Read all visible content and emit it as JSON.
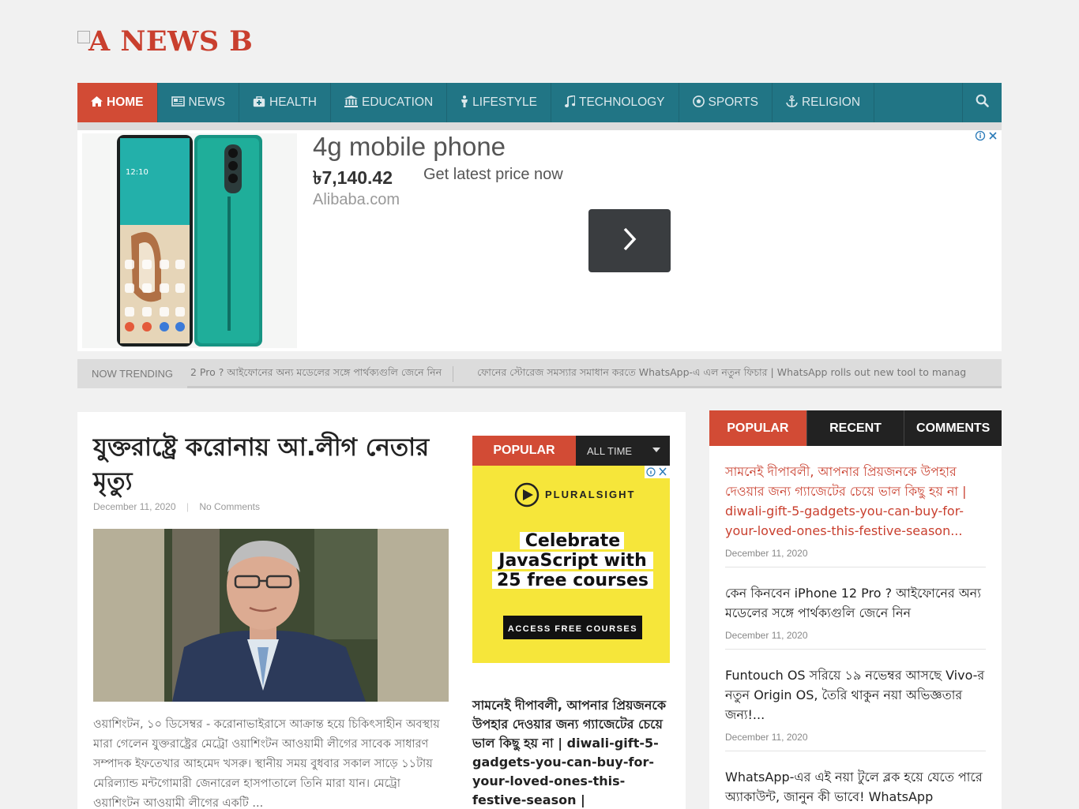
{
  "logo": {
    "text": "A NEWS B"
  },
  "nav": {
    "items": [
      {
        "label": "HOME",
        "icon": "home-icon"
      },
      {
        "label": "NEWS",
        "icon": "newspaper-icon"
      },
      {
        "label": "HEALTH",
        "icon": "medkit-icon"
      },
      {
        "label": "EDUCATION",
        "icon": "institution-icon"
      },
      {
        "label": "LIFESTYLE",
        "icon": "person-icon"
      },
      {
        "label": "TECHNOLOGY",
        "icon": "music-icon"
      },
      {
        "label": "SPORTS",
        "icon": "soccer-ball-icon"
      },
      {
        "label": "RELIGION",
        "icon": "anchor-icon"
      }
    ]
  },
  "ad": {
    "title": "4g mobile phone",
    "price": "৳7,140.42",
    "cta": "Get latest price now",
    "source": "Alibaba.com"
  },
  "trending": {
    "label": "NOW TRENDING",
    "items": [
      "2 Pro ? আইফোনের অন্য মডেলের সঙ্গে পার্থক্যগুলি জেনে নিন",
      "ফোনের স্টোরেজ সমস্যার সমাধান করতে WhatsApp-এ এল নতুন ফিচার | WhatsApp rolls out new tool to manag"
    ]
  },
  "article": {
    "headline": "যুক্তরাষ্ট্রে করোনায় আ.লীগ নেতার মৃত্যু",
    "date": "December 11, 2020",
    "comments": "No Comments",
    "excerpt": "ওয়াশিংটন, ১০ ডিসেম্বর - করোনাভাইরাসে আক্রান্ত হয়ে চিকিৎসাহীন অবস্থায় মারা গেলেন যুক্তরাষ্ট্রের মেট্রো ওয়াশিংটন আওয়ামী লীগের সাবেক সাধারণ সম্পাদক ইফতেখার আহমেদ খসরু। স্থানীয় সময় বুধবার সকাল সাড়ে ১১টায় মেরিল্যান্ড মন্টগোমারী জেনারেল হাসপাতালে তিনি মারা যান। মেট্রো ওয়াশিংটন আওয়ামী লীগের একটি ..."
  },
  "popular_widget": {
    "tab": "POPULAR",
    "range": "ALL TIME",
    "ad": {
      "brand": "PLURALSIGHT",
      "line1": "Celebrate",
      "line2": "JavaScript with",
      "line3": "25 free courses",
      "button": "ACCESS FREE COURSES"
    },
    "story": "সামনেই দীপাবলী, আপনার প্রিয়জনকে উপহার দেওয়ার জন্য গ্যাজেটের চেয়ে ভাল কিছু হয় না | diwali-gift-5-gadgets-you-can-buy-for-your-loved-ones-this-festive-season |"
  },
  "sidebar": {
    "tabs": [
      "POPULAR",
      "RECENT",
      "COMMENTS"
    ],
    "entries": [
      {
        "title": "সামনেই দীপাবলী, আপনার প্রিয়জনকে উপহার দেওয়ার জন্য গ্যাজেটের চেয়ে ভাল কিছু হয় না | diwali-gift-5-gadgets-you-can-buy-for-your-loved-ones-this-festive-season...",
        "date": "December 11, 2020"
      },
      {
        "title": "কেন কিনবেন iPhone 12 Pro ? আইফোনের অন্য মডেলের সঙ্গে পার্থক্যগুলি জেনে নিন",
        "date": "December 11, 2020"
      },
      {
        "title": "Funtouch OS সরিয়ে ১৯ নভেম্বর আসছে Vivo-র নতুন Origin OS, তৈরি থাকুন নয়া অভিজ্ঞতার জন্য!...",
        "date": "December 11, 2020"
      },
      {
        "title": "WhatsApp-এর এই নয়া টুলে ব্লক হয়ে যেতে পারে অ্যাকাউন্ট, জানুন কী ভাবে! WhatsApp",
        "date": ""
      }
    ]
  },
  "colors": {
    "accent": "#d24b35",
    "nav": "#217585",
    "dark": "#222222"
  }
}
